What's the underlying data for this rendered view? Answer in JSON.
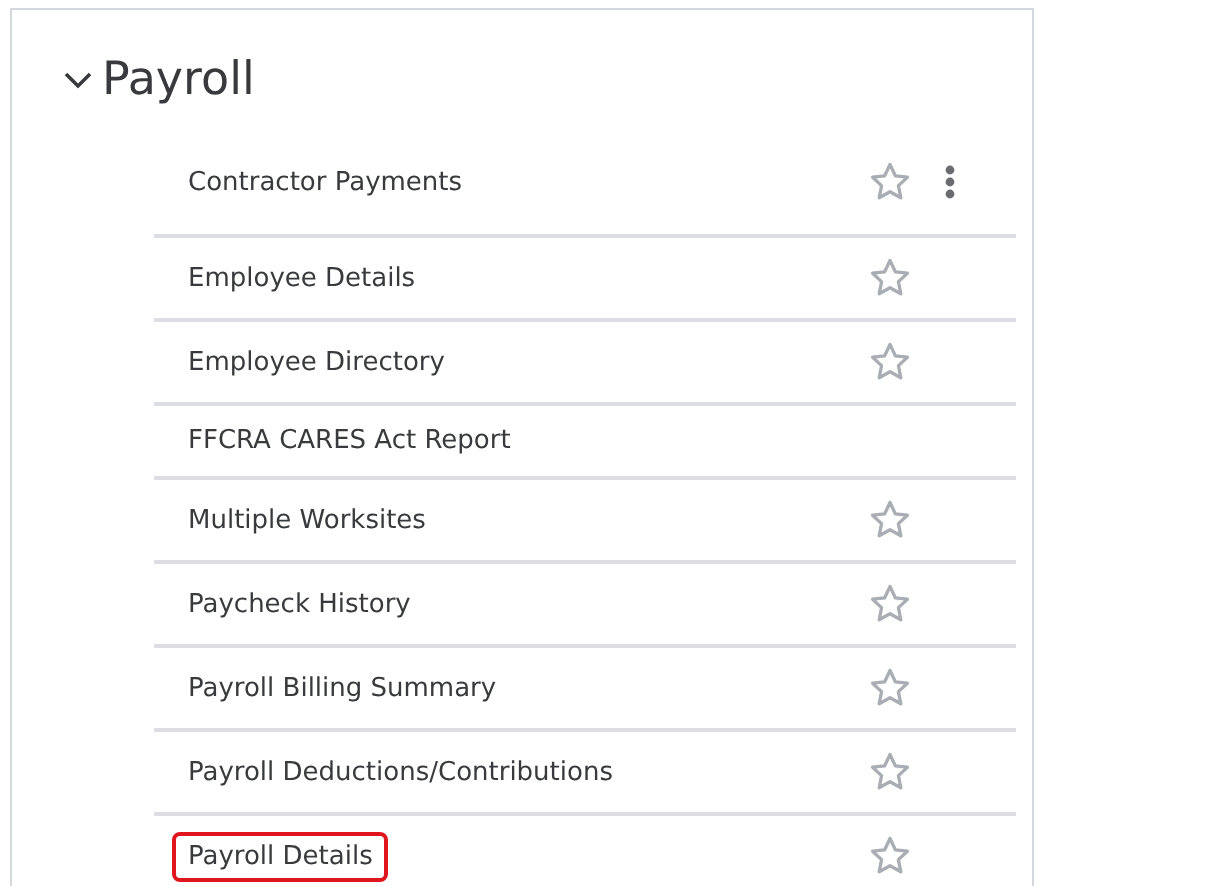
{
  "section": {
    "title": "Payroll",
    "expanded": true
  },
  "reports": [
    {
      "label": "Contractor Payments",
      "kind": "menu",
      "favorite": false,
      "highlighted": false
    },
    {
      "label": "Employee Details",
      "kind": "star",
      "favorite": false,
      "highlighted": false
    },
    {
      "label": "Employee Directory",
      "kind": "star",
      "favorite": false,
      "highlighted": false
    },
    {
      "label": "FFCRA CARES Act Report",
      "kind": "plain",
      "highlighted": false
    },
    {
      "label": "Multiple Worksites",
      "kind": "star",
      "favorite": false,
      "highlighted": false
    },
    {
      "label": "Paycheck History",
      "kind": "star",
      "favorite": false,
      "highlighted": false
    },
    {
      "label": "Payroll Billing Summary",
      "kind": "star",
      "favorite": false,
      "highlighted": false
    },
    {
      "label": "Payroll Deductions/Contributions",
      "kind": "star",
      "favorite": false,
      "highlighted": false
    },
    {
      "label": "Payroll Details",
      "kind": "star",
      "favorite": false,
      "highlighted": true
    }
  ]
}
